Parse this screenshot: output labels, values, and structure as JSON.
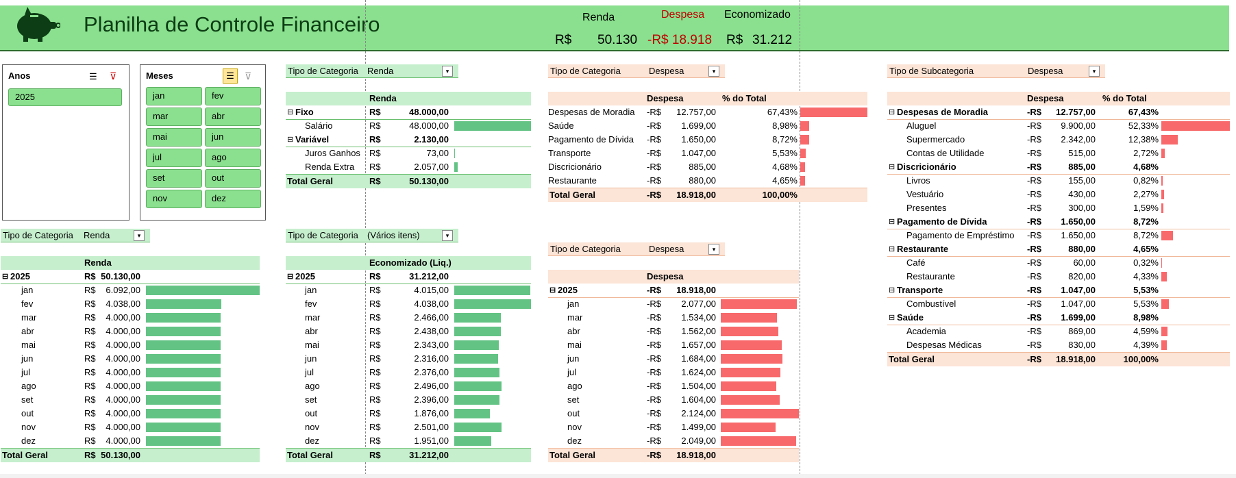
{
  "header": {
    "title": "Planilha de Controle Financeiro",
    "kpi": {
      "renda_label": "Renda",
      "despesa_label": "Despesa",
      "economizado_label": "Economizado",
      "currency": "R$",
      "renda_value": "50.130",
      "despesa_value": "-R$ 18.918",
      "economizado_value": "31.212"
    },
    "colors": {
      "header_bg": "#8AE08E",
      "despesa": "#C00000",
      "green_bar": "#63C384",
      "red_bar": "#F8696B"
    }
  },
  "slicer_anos": {
    "title": "Anos",
    "items": [
      "2025"
    ]
  },
  "slicer_meses": {
    "title": "Meses",
    "items": [
      "jan",
      "fev",
      "mar",
      "abr",
      "mai",
      "jun",
      "jul",
      "ago",
      "set",
      "out",
      "nov",
      "dez"
    ]
  },
  "pivot_renda_cat": {
    "filter_label": "Tipo de Categoria",
    "filter_value": "Renda",
    "col_header": "Renda",
    "rows": [
      {
        "label": "Fixo",
        "cur": "R$",
        "value": "48.000,00",
        "bold": true,
        "expander": true
      },
      {
        "label": "Salário",
        "cur": "R$",
        "value": "48.000,00",
        "bar": 48000
      },
      {
        "label": "Variável",
        "cur": "R$",
        "value": "2.130,00",
        "bold": true,
        "expander": true
      },
      {
        "label": "Juros Ganhos",
        "cur": "R$",
        "value": "73,00",
        "bar": 73
      },
      {
        "label": "Renda Extra",
        "cur": "R$",
        "value": "2.057,00",
        "bar": 2057
      }
    ],
    "total_label": "Total Geral",
    "total_cur": "R$",
    "total_value": "50.130,00"
  },
  "pivot_despesa_cat": {
    "filter_label": "Tipo de Categoria",
    "filter_value": "Despesa",
    "col_header": "Despesa",
    "col_header2": "% do Total",
    "rows": [
      {
        "label": "Despesas de Moradia",
        "cur": "-R$",
        "value": "12.757,00",
        "pct": "67,43%",
        "bar": 67.43
      },
      {
        "label": "Saúde",
        "cur": "-R$",
        "value": "1.699,00",
        "pct": "8,98%",
        "bar": 8.98
      },
      {
        "label": "Pagamento de Dívida",
        "cur": "-R$",
        "value": "1.650,00",
        "pct": "8,72%",
        "bar": 8.72
      },
      {
        "label": "Transporte",
        "cur": "-R$",
        "value": "1.047,00",
        "pct": "5,53%",
        "bar": 5.53
      },
      {
        "label": "Discricionário",
        "cur": "-R$",
        "value": "885,00",
        "pct": "4,68%",
        "bar": 4.68
      },
      {
        "label": "Restaurante",
        "cur": "-R$",
        "value": "880,00",
        "pct": "4,65%",
        "bar": 4.65
      }
    ],
    "total_label": "Total Geral",
    "total_cur": "-R$",
    "total_value": "18.918,00",
    "total_pct": "100,00%"
  },
  "pivot_subcat": {
    "filter_label": "Tipo de Subcategoria",
    "filter_value": "Despesa",
    "col_header": "Despesa",
    "col_header2": "% do Total",
    "rows": [
      {
        "label": "Despesas de Moradia",
        "cur": "-R$",
        "value": "12.757,00",
        "pct": "67,43%",
        "bold": true,
        "expander": true
      },
      {
        "label": "Aluguel",
        "cur": "-R$",
        "value": "9.900,00",
        "pct": "52,33%",
        "bar": 52.33
      },
      {
        "label": "Supermercado",
        "cur": "-R$",
        "value": "2.342,00",
        "pct": "12,38%",
        "bar": 12.38
      },
      {
        "label": "Contas de Utilidade",
        "cur": "-R$",
        "value": "515,00",
        "pct": "2,72%",
        "bar": 2.72
      },
      {
        "label": "Discricionário",
        "cur": "-R$",
        "value": "885,00",
        "pct": "4,68%",
        "bold": true,
        "expander": true
      },
      {
        "label": "Livros",
        "cur": "-R$",
        "value": "155,00",
        "pct": "0,82%",
        "bar": 0.82
      },
      {
        "label": "Vestuário",
        "cur": "-R$",
        "value": "430,00",
        "pct": "2,27%",
        "bar": 2.27
      },
      {
        "label": "Presentes",
        "cur": "-R$",
        "value": "300,00",
        "pct": "1,59%",
        "bar": 1.59
      },
      {
        "label": "Pagamento de Dívida",
        "cur": "-R$",
        "value": "1.650,00",
        "pct": "8,72%",
        "bold": true,
        "expander": true
      },
      {
        "label": "Pagamento de Empréstimo",
        "cur": "-R$",
        "value": "1.650,00",
        "pct": "8,72%",
        "bar": 8.72
      },
      {
        "label": "Restaurante",
        "cur": "-R$",
        "value": "880,00",
        "pct": "4,65%",
        "bold": true,
        "expander": true
      },
      {
        "label": "Café",
        "cur": "-R$",
        "value": "60,00",
        "pct": "0,32%",
        "bar": 0.32
      },
      {
        "label": "Restaurante",
        "cur": "-R$",
        "value": "820,00",
        "pct": "4,33%",
        "bar": 4.33
      },
      {
        "label": "Transporte",
        "cur": "-R$",
        "value": "1.047,00",
        "pct": "5,53%",
        "bold": true,
        "expander": true
      },
      {
        "label": "Combustível",
        "cur": "-R$",
        "value": "1.047,00",
        "pct": "5,53%",
        "bar": 5.53
      },
      {
        "label": "Saúde",
        "cur": "-R$",
        "value": "1.699,00",
        "pct": "8,98%",
        "bold": true,
        "expander": true
      },
      {
        "label": "Academia",
        "cur": "-R$",
        "value": "869,00",
        "pct": "4,59%",
        "bar": 4.59
      },
      {
        "label": "Despesas Médicas",
        "cur": "-R$",
        "value": "830,00",
        "pct": "4,39%",
        "bar": 4.39
      }
    ],
    "total_label": "Total Geral",
    "total_cur": "-R$",
    "total_value": "18.918,00",
    "total_pct": "100,00%"
  },
  "pivot_renda_mes": {
    "filter_label": "Tipo de Categoria",
    "filter_value": "Renda",
    "col_header": "Renda",
    "year_label": "2025",
    "year_cur": "R$",
    "year_value": "50.130,00",
    "rows": [
      {
        "label": "jan",
        "cur": "R$",
        "value": "6.092,00",
        "bar": 6092
      },
      {
        "label": "fev",
        "cur": "R$",
        "value": "4.038,00",
        "bar": 4038
      },
      {
        "label": "mar",
        "cur": "R$",
        "value": "4.000,00",
        "bar": 4000
      },
      {
        "label": "abr",
        "cur": "R$",
        "value": "4.000,00",
        "bar": 4000
      },
      {
        "label": "mai",
        "cur": "R$",
        "value": "4.000,00",
        "bar": 4000
      },
      {
        "label": "jun",
        "cur": "R$",
        "value": "4.000,00",
        "bar": 4000
      },
      {
        "label": "jul",
        "cur": "R$",
        "value": "4.000,00",
        "bar": 4000
      },
      {
        "label": "ago",
        "cur": "R$",
        "value": "4.000,00",
        "bar": 4000
      },
      {
        "label": "set",
        "cur": "R$",
        "value": "4.000,00",
        "bar": 4000
      },
      {
        "label": "out",
        "cur": "R$",
        "value": "4.000,00",
        "bar": 4000
      },
      {
        "label": "nov",
        "cur": "R$",
        "value": "4.000,00",
        "bar": 4000
      },
      {
        "label": "dez",
        "cur": "R$",
        "value": "4.000,00",
        "bar": 4000
      }
    ],
    "total_label": "Total Geral",
    "total_cur": "R$",
    "total_value": "50.130,00"
  },
  "pivot_econ_mes": {
    "filter_label": "Tipo de Categoria",
    "filter_value": "(Vários itens)",
    "col_header": "Economizado (Liq.)",
    "year_label": "2025",
    "year_cur": "R$",
    "year_value": "31.212,00",
    "rows": [
      {
        "label": "jan",
        "cur": "R$",
        "value": "4.015,00",
        "bar": 4015
      },
      {
        "label": "fev",
        "cur": "R$",
        "value": "4.038,00",
        "bar": 4038
      },
      {
        "label": "mar",
        "cur": "R$",
        "value": "2.466,00",
        "bar": 2466
      },
      {
        "label": "abr",
        "cur": "R$",
        "value": "2.438,00",
        "bar": 2438
      },
      {
        "label": "mai",
        "cur": "R$",
        "value": "2.343,00",
        "bar": 2343
      },
      {
        "label": "jun",
        "cur": "R$",
        "value": "2.316,00",
        "bar": 2316
      },
      {
        "label": "jul",
        "cur": "R$",
        "value": "2.376,00",
        "bar": 2376
      },
      {
        "label": "ago",
        "cur": "R$",
        "value": "2.496,00",
        "bar": 2496
      },
      {
        "label": "set",
        "cur": "R$",
        "value": "2.396,00",
        "bar": 2396
      },
      {
        "label": "out",
        "cur": "R$",
        "value": "1.876,00",
        "bar": 1876
      },
      {
        "label": "nov",
        "cur": "R$",
        "value": "2.501,00",
        "bar": 2501
      },
      {
        "label": "dez",
        "cur": "R$",
        "value": "1.951,00",
        "bar": 1951
      }
    ],
    "total_label": "Total Geral",
    "total_cur": "R$",
    "total_value": "31.212,00"
  },
  "pivot_desp_mes": {
    "filter_label": "Tipo de Categoria",
    "filter_value": "Despesa",
    "col_header": "Despesa",
    "year_label": "2025",
    "year_cur": "-R$",
    "year_value": "18.918,00",
    "rows": [
      {
        "label": "jan",
        "cur": "-R$",
        "value": "2.077,00",
        "bar": 2077
      },
      {
        "label": "mar",
        "cur": "-R$",
        "value": "1.534,00",
        "bar": 1534
      },
      {
        "label": "abr",
        "cur": "-R$",
        "value": "1.562,00",
        "bar": 1562
      },
      {
        "label": "mai",
        "cur": "-R$",
        "value": "1.657,00",
        "bar": 1657
      },
      {
        "label": "jun",
        "cur": "-R$",
        "value": "1.684,00",
        "bar": 1684
      },
      {
        "label": "jul",
        "cur": "-R$",
        "value": "1.624,00",
        "bar": 1624
      },
      {
        "label": "ago",
        "cur": "-R$",
        "value": "1.504,00",
        "bar": 1504
      },
      {
        "label": "set",
        "cur": "-R$",
        "value": "1.604,00",
        "bar": 1604
      },
      {
        "label": "out",
        "cur": "-R$",
        "value": "2.124,00",
        "bar": 2124
      },
      {
        "label": "nov",
        "cur": "-R$",
        "value": "1.499,00",
        "bar": 1499
      },
      {
        "label": "dez",
        "cur": "-R$",
        "value": "2.049,00",
        "bar": 2049
      }
    ],
    "total_label": "Total Geral",
    "total_cur": "-R$",
    "total_value": "18.918,00"
  }
}
